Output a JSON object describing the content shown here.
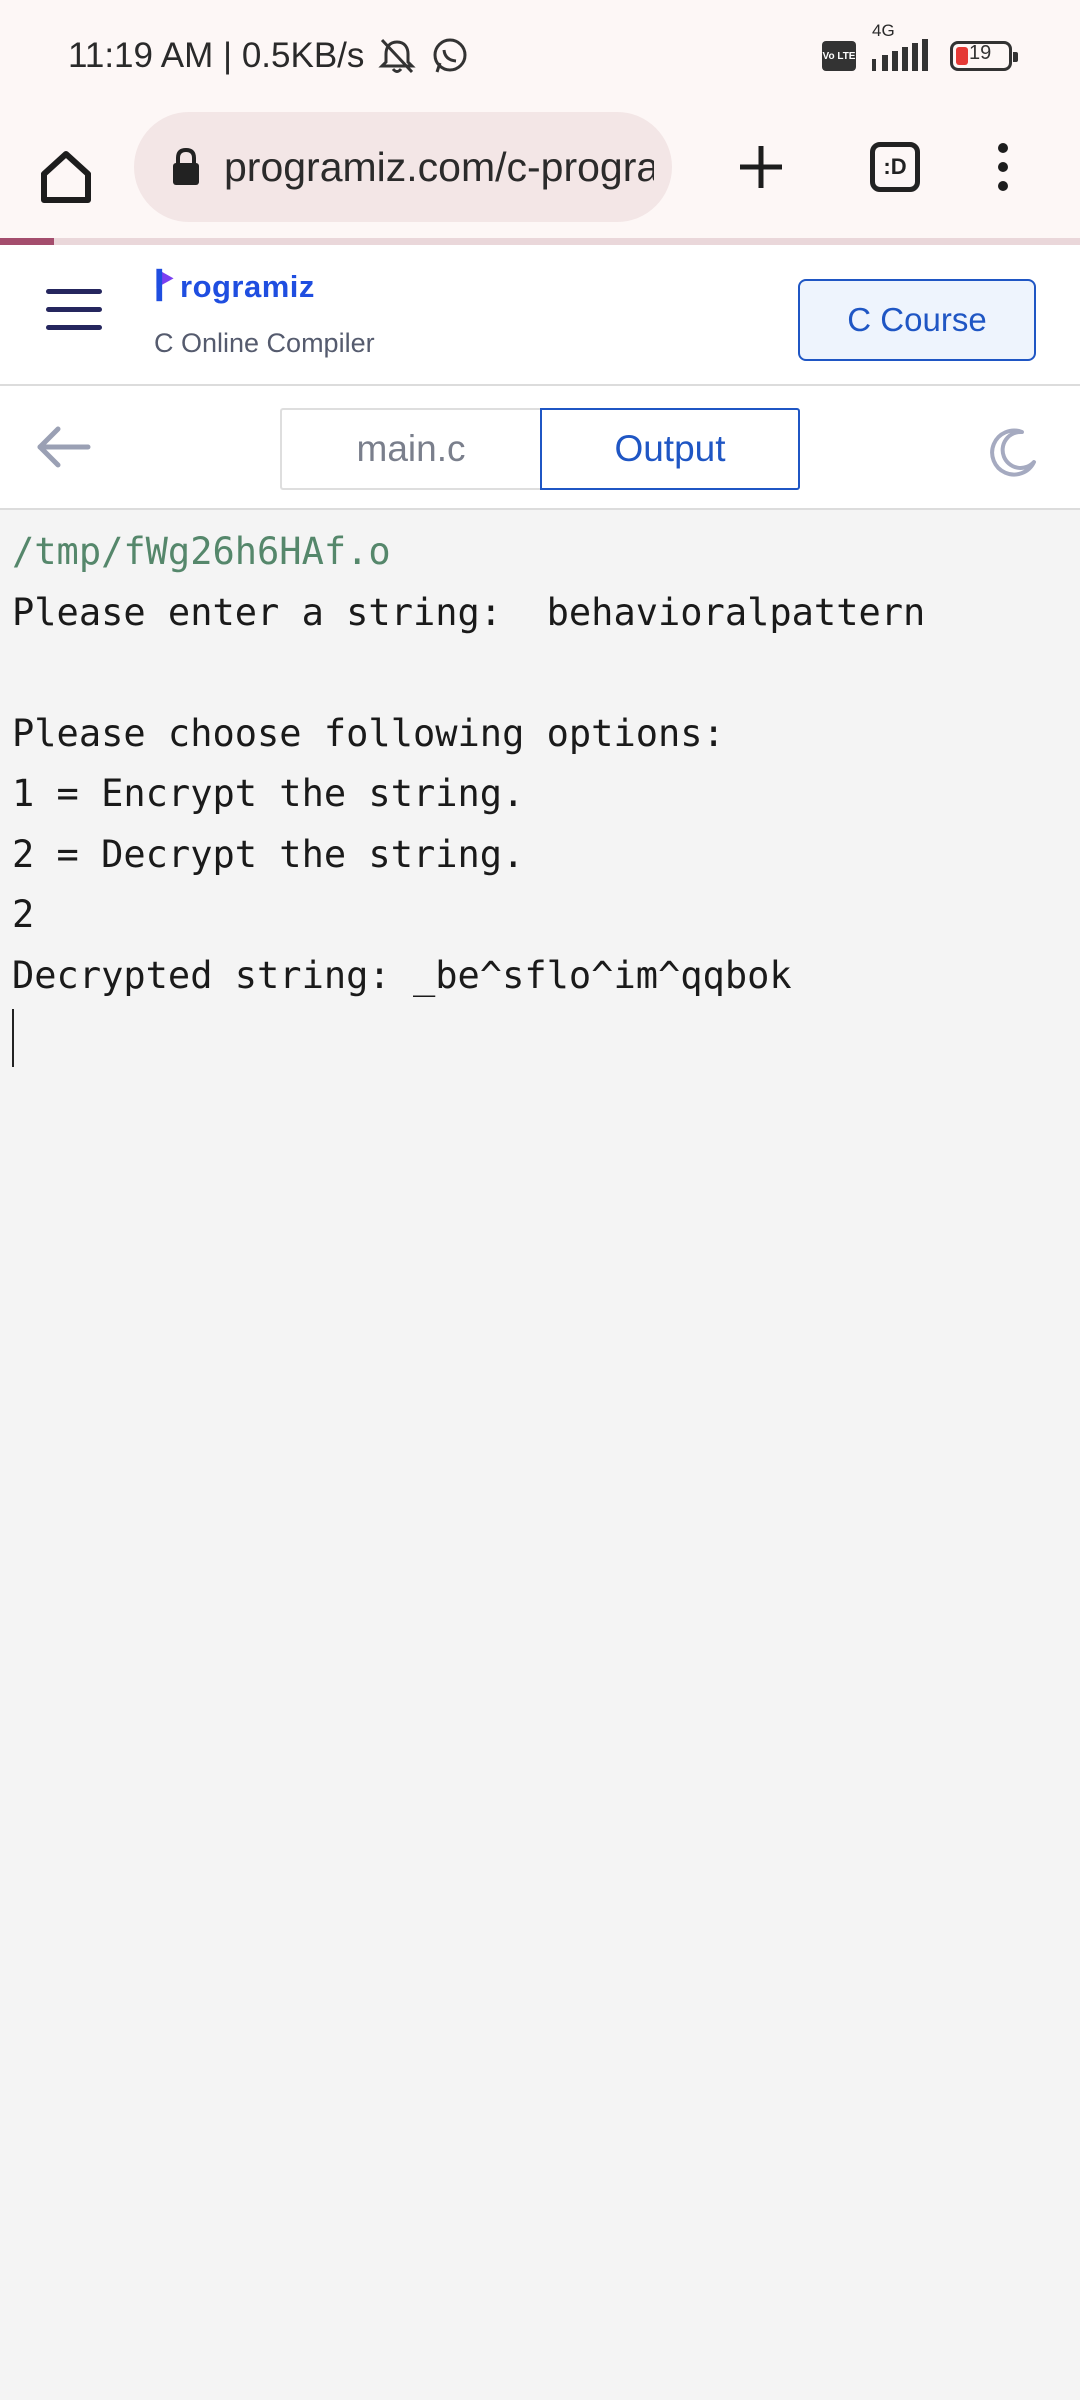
{
  "status_bar": {
    "time_speed": "11:19 AM | 0.5KB/s",
    "network": "4G",
    "volte": "Vo LTE",
    "battery": "19"
  },
  "browser": {
    "url": "programiz.com/c-programming/online-compiler",
    "tab_count_label": ":D"
  },
  "site": {
    "logo_text": "rogramiz",
    "logo_initial": "P",
    "subtitle": "C Online Compiler",
    "course_button": "C Course",
    "brand_color": "#1f56c4"
  },
  "tabs": [
    {
      "label": "main.c",
      "active": false
    },
    {
      "label": "Output",
      "active": true
    }
  ],
  "console": {
    "path": "/tmp/fWg26h6HAf.o",
    "lines": [
      "Please enter a string:  behavioralpattern",
      "",
      "Please choose following options:",
      "1 = Encrypt the string.",
      "2 = Decrypt the string.",
      "2",
      "Decrypted string: _be^sflo^im^qqbok"
    ]
  }
}
